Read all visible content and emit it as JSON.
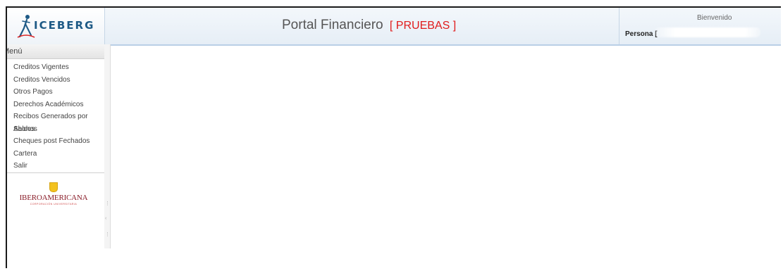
{
  "header": {
    "logo_text": "ICEBERG",
    "title": "Portal Financiero",
    "title_tag": "[ PRUEBAS ]",
    "welcome": "Bienvenido",
    "persona_label": "Persona ["
  },
  "sidebar": {
    "menu_title": "Menú",
    "items": [
      {
        "label": "Creditos Vigentes"
      },
      {
        "label": "Creditos Vencidos"
      },
      {
        "label": "Otros Pagos"
      },
      {
        "label": "Derechos Académicos"
      },
      {
        "label": "Recibos Generados por Saldos"
      },
      {
        "label": "Abonos"
      },
      {
        "label": "Cheques post Fechados"
      },
      {
        "label": "Cartera"
      },
      {
        "label": "Salir"
      }
    ],
    "university": {
      "name": "IBEROAMERICANA",
      "subtitle": "CORPORACIÓN UNIVERSITARIA"
    }
  },
  "colors": {
    "accent": "#1e5a86",
    "tag": "#e01b1b"
  }
}
